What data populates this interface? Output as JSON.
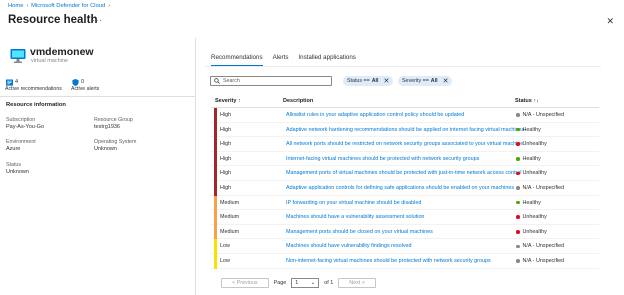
{
  "breadcrumb": {
    "home": "Home",
    "defender": "Microsoft Defender for Cloud"
  },
  "page": {
    "title": "Resource health",
    "more": "···",
    "close": "✕"
  },
  "resource": {
    "name": "vmdemonew",
    "type": "virtual machine"
  },
  "stats": {
    "recommendations_count": "4",
    "recommendations_label": "Active recommendations",
    "alerts_count": "0",
    "alerts_label": "Active alerts"
  },
  "info": {
    "title": "Resource information",
    "subscription_label": "Subscription",
    "subscription_value": "Pay-As-You-Go",
    "resource_group_label": "Resource Group",
    "resource_group_value": "testrg1936",
    "environment_label": "Environment",
    "environment_value": "Azure",
    "os_label": "Operating System",
    "os_value": "Unknown",
    "status_label": "Status",
    "status_value": "Unknown"
  },
  "tabs": [
    "Recommendations",
    "Alerts",
    "Installed applications"
  ],
  "filters": {
    "search_placeholder": "Search",
    "status_prefix": "Status ==",
    "status_value": "All",
    "severity_prefix": "Severity ==",
    "severity_value": "All"
  },
  "table": {
    "headers": {
      "severity": "Severity ↑",
      "description": "Description",
      "status": "Status ↑↓"
    },
    "rows": [
      {
        "severity": "High",
        "description": "Allowlist rules in your adaptive application control policy should be updated",
        "status": "N/A - Unspecified"
      },
      {
        "severity": "High",
        "description": "Adaptive network hardening recommendations should be applied on internet facing virtual machines",
        "status": "Healthy"
      },
      {
        "severity": "High",
        "description": "All network ports should be restricted on network security groups associated to your virtual machine",
        "status": "Unhealthy"
      },
      {
        "severity": "High",
        "description": "Internet-facing virtual machines should be protected with network security groups",
        "status": "Healthy"
      },
      {
        "severity": "High",
        "description": "Management ports of virtual machines should be protected with just-in-time network access control",
        "status": "Unhealthy"
      },
      {
        "severity": "High",
        "description": "Adaptive application controls for defining safe applications should be enabled on your machines",
        "status": "N/A - Unspecified"
      },
      {
        "severity": "Medium",
        "description": "IP forwarding on your virtual machine should be disabled",
        "status": "Healthy"
      },
      {
        "severity": "Medium",
        "description": "Machines should have a vulnerability assessment solution",
        "status": "Unhealthy"
      },
      {
        "severity": "Medium",
        "description": "Management ports should be closed on your virtual machines",
        "status": "Unhealthy"
      },
      {
        "severity": "Low",
        "description": "Machines should have vulnerability findings resolved",
        "status": "N/A - Unspecified"
      },
      {
        "severity": "Low",
        "description": "Non-internet-facing virtual machines should be protected with network security groups",
        "status": "N/A - Unspecified"
      }
    ]
  },
  "pager": {
    "previous": "< Previous",
    "page_label": "Page",
    "page_value": "1",
    "of_label": "of 1",
    "next": "Next >"
  },
  "colors": {
    "accent": "#0078d4",
    "high": "#a4262c",
    "medium": "#f7a24b",
    "low": "#fce100",
    "healthy": "#57a300",
    "unhealthy": "#e00b1c",
    "na": "#8a8886"
  }
}
